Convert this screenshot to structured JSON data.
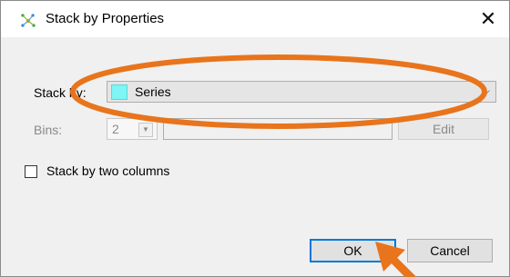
{
  "window": {
    "title": "Stack by Properties",
    "close_glyph": "✕",
    "icon": "spotfire-app-icon"
  },
  "form": {
    "stack_by_label": "Stack by:",
    "stack_by_value": "Series",
    "stack_by_swatch_color": "#7ff5f5",
    "bins_label": "Bins:",
    "bins_value": "2",
    "bins_field_value": "",
    "edit_label": "Edit",
    "two_columns_label": "Stack by two columns",
    "two_columns_checked": false
  },
  "buttons": {
    "ok": "OK",
    "cancel": "Cancel"
  },
  "annotations": {
    "highlight_color": "#e8741c",
    "shapes": [
      "ellipse around Stack by dropdown",
      "arrow pointing to OK button"
    ]
  }
}
